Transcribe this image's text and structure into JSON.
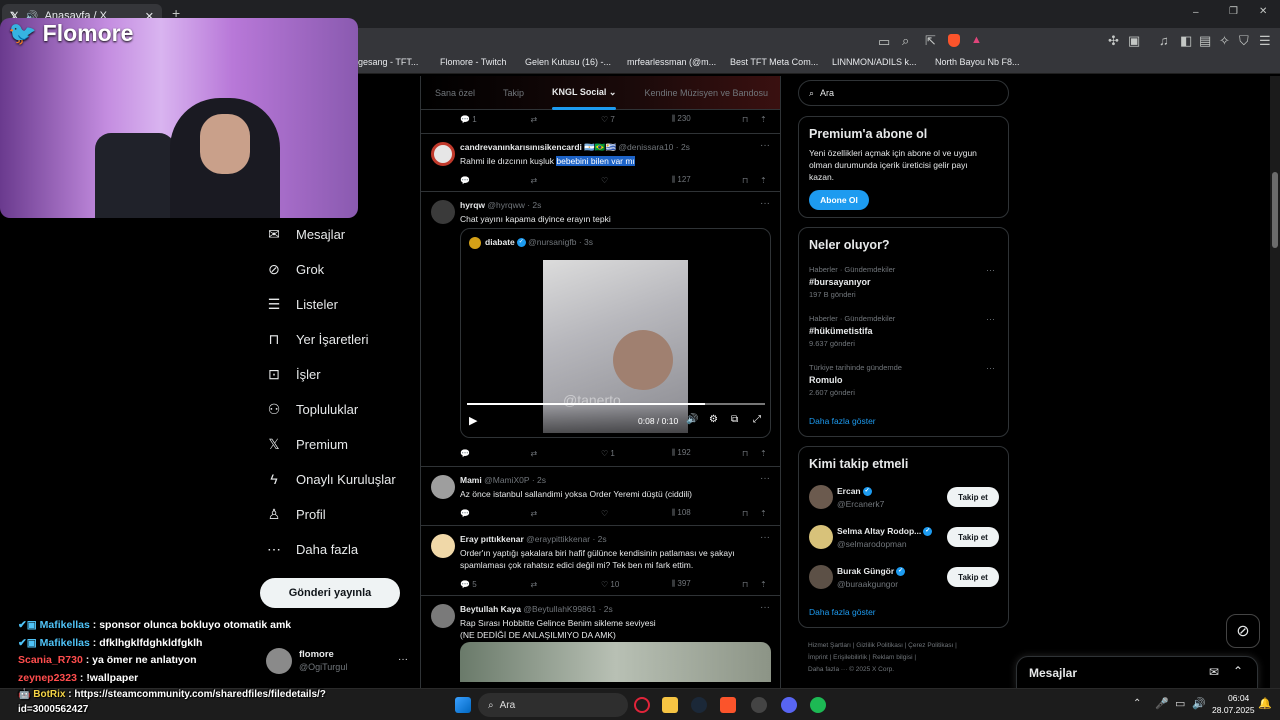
{
  "browser": {
    "tab_title": "Anasayfa / X",
    "new_tab": "+",
    "window_controls": [
      "–",
      "❐",
      "✕"
    ],
    "bookmarks": [
      "gesang - TFT...",
      "Flomore - Twitch",
      "Gelen Kutusu (16) -...",
      "mrfearlessman (@m...",
      "Best TFT Meta Com...",
      "LINNMON/ADILS k...",
      "North Bayou Nb F8..."
    ]
  },
  "stream": {
    "brand": "Flomore",
    "chat": [
      {
        "user": "Mafikellas",
        "text": "sponsor olunca bokluyo otomatik amk",
        "color": "#4fc3f7"
      },
      {
        "user": "Mafikellas",
        "text": "dfklhgklfdghkldfgklh",
        "color": "#4fc3f7"
      },
      {
        "user": "Scania_R730",
        "text": "ya ömer ne anlatıyon",
        "color": "#ff4d4d"
      },
      {
        "user": "zeynep2323",
        "text": "!wallpaper",
        "color": "#ff4d4d"
      },
      {
        "user": "BotRix",
        "text": "https://steamcommunity.com/sharedfiles/filedetails/?",
        "color": "#f5d547"
      },
      {
        "user": "",
        "text": "id=3000562427",
        "color": "#ffffff"
      }
    ]
  },
  "nav": {
    "items": [
      {
        "label": "Mesajlar",
        "icon": "✉"
      },
      {
        "label": "Grok",
        "icon": "⊘"
      },
      {
        "label": "Listeler",
        "icon": "☰"
      },
      {
        "label": "Yer İşaretleri",
        "icon": "⊓"
      },
      {
        "label": "İşler",
        "icon": "⊡"
      },
      {
        "label": "Topluluklar",
        "icon": "⚇"
      },
      {
        "label": "Premium",
        "icon": "𝕏"
      },
      {
        "label": "Onaylı Kuruluşlar",
        "icon": "ϟ"
      },
      {
        "label": "Profil",
        "icon": "♙"
      },
      {
        "label": "Daha fazla",
        "icon": "⋯"
      }
    ],
    "post_button": "Gönderi yayınla",
    "account_name": "flomore",
    "account_handle": "@OgiTurgul",
    "account_more": "···"
  },
  "feed": {
    "tabs": [
      "Sana özel",
      "Takip",
      "KNGL Social",
      "Kendine Müzisyen ve Bandosu"
    ],
    "active_tab": "KNGL Social",
    "top_actions": {
      "replies": "1",
      "likes": "7",
      "views": "230"
    },
    "posts": [
      {
        "name": "candrevanınkarısınısikencardi",
        "flags": "🇦🇷🇧🇷🇺🇾",
        "handle": "@denissara10",
        "time": "· 2s",
        "text_before": "Rahmi ile dızcının kuşluk ",
        "text_highlight": "bebebini bilen var mı",
        "replies": "",
        "retweets": "",
        "likes": "",
        "views": "127"
      },
      {
        "name": "hyrqw",
        "handle": "@hyrqww",
        "time": "· 2s",
        "text": "Chat yayını kapama diyince erayın tepki",
        "embed": {
          "name": "diabate",
          "handle": "@nursanigfb",
          "time": "· 3s",
          "video_time": "0:08 / 0:10",
          "watermark": "@tanerto",
          "progress": 0.8
        },
        "replies": "",
        "retweets": "",
        "likes": "1",
        "views": "192"
      },
      {
        "name": "Mami",
        "handle": "@MamiX0P",
        "time": "· 2s",
        "text": "Az önce istanbul sallandimi yoksa Order Yeremi düştü (ciddili)",
        "replies": "",
        "retweets": "",
        "likes": "",
        "views": "108"
      },
      {
        "name": "Eray pıttıkkenar",
        "handle": "@eraypittikkenar",
        "time": "· 2s",
        "text1": "Order'ın yaptığı şakalara biri hafif gülünce kendisinin patlaması ve şakayı",
        "text2": "spamlaması çok rahatsız edici değil mi? Tek ben mi fark ettim.",
        "replies": "5",
        "retweets": "",
        "likes": "10",
        "views": "397"
      },
      {
        "name": "Beytullah Kaya",
        "handle": "@BeytullahK99861",
        "time": "· 2s",
        "text1": "Rap Sırası Hobbitte Gelince Benim sikleme seviyesi",
        "text2": "(NE DEDİĞİ DE ANLAŞILMIYO DA AMK)"
      }
    ]
  },
  "right": {
    "search_placeholder": "Ara",
    "premium": {
      "title": "Premium'a abone ol",
      "body": "Yeni özellikleri açmak için abone ol ve uygun olman durumunda içerik üreticisi gelir payı kazan.",
      "button": "Abone Ol"
    },
    "trends": {
      "title": "Neler oluyor?",
      "items": [
        {
          "context": "Haberler · Gündemdekiler",
          "name": "#bursayanıyor",
          "count": "197 B gönderi"
        },
        {
          "context": "Haberler · Gündemdekiler",
          "name": "#hükümetistifa",
          "count": "9.637 gönderi"
        },
        {
          "context": "Türkiye tarihinde gündemde",
          "name": "Romulo",
          "count": "2.607 gönderi"
        }
      ],
      "more": "Daha fazla göster"
    },
    "who": {
      "title": "Kimi takip etmeli",
      "items": [
        {
          "name": "Ercan",
          "handle": "@Ercanerk7",
          "button": "Takip et"
        },
        {
          "name": "Selma Altay Rodop...",
          "handle": "@selmarodopman",
          "button": "Takip et"
        },
        {
          "name": "Burak Güngör",
          "handle": "@buraakgungor",
          "button": "Takip et"
        }
      ],
      "more": "Daha fazla göster"
    },
    "footer": {
      "line1": "Hizmet Şartları  |  Gizlilik Politikası  |  Çerez Politikası  |",
      "line2": "İmprint  |  Erişilebilirlik  |  Reklam bilgisi  |",
      "line3": "Daha fazla ···  © 2025 X Corp."
    },
    "messages_dock": "Mesajlar"
  },
  "taskbar": {
    "search": "Ara",
    "time": "06:04",
    "date": "28.07.2025"
  }
}
